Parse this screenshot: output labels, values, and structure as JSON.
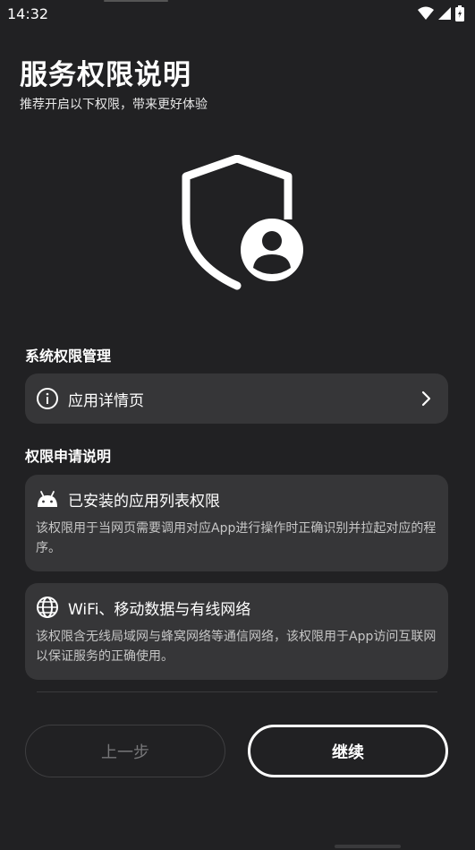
{
  "status_bar": {
    "time": "14:32"
  },
  "header": {
    "title": "服务权限说明",
    "subtitle": "推荐开启以下权限，带来更好体验"
  },
  "system_section": {
    "label": "系统权限管理",
    "item": {
      "label": "应用详情页",
      "icon": "info-icon"
    }
  },
  "permission_section": {
    "label": "权限申请说明",
    "items": [
      {
        "icon": "android-icon",
        "title": "已安装的应用列表权限",
        "description": "该权限用于当网页需要调用对应App进行操作时正确识别并拉起对应的程序。"
      },
      {
        "icon": "globe-icon",
        "title": "WiFi、移动数据与有线网络",
        "description": "该权限含无线局域网与蜂窝网络等通信网络，该权限用于App访问互联网以保证服务的正确使用。"
      }
    ]
  },
  "buttons": {
    "back": "上一步",
    "next": "继续"
  }
}
